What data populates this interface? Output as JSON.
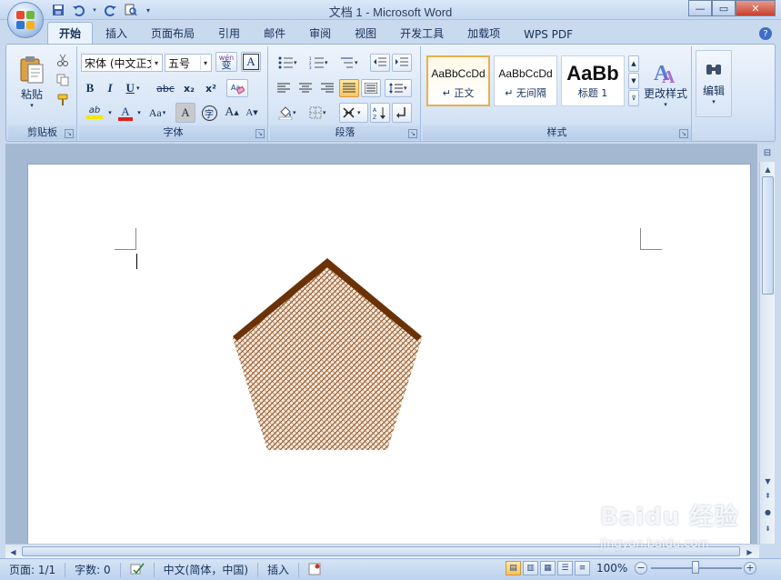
{
  "window": {
    "title": "文档 1 - Microsoft Word"
  },
  "tabs": [
    "开始",
    "插入",
    "页面布局",
    "引用",
    "邮件",
    "审阅",
    "视图",
    "开发工具",
    "加载项",
    "WPS PDF"
  ],
  "ribbon": {
    "clipboard": {
      "label": "剪贴板",
      "paste": "粘贴"
    },
    "font": {
      "label": "字体",
      "font_name": "宋体 (中文正文",
      "font_size": "五号",
      "wen_label": "wén\n变",
      "a_box": "A",
      "bold": "B",
      "italic": "I",
      "underline": "U",
      "strike": "abc",
      "subscript": "x₂",
      "superscript": "x²",
      "highlight": "ab",
      "fontcolor": "A",
      "case": "Aa",
      "shade_a": "A",
      "circle_char": "字",
      "grow": "A",
      "shrink": "A"
    },
    "paragraph": {
      "label": "段落"
    },
    "styles": {
      "label": "样式",
      "items": [
        {
          "sample": "AaBbCcDd",
          "name": "↵ 正文"
        },
        {
          "sample": "AaBbCcDd",
          "name": "↵ 无间隔"
        },
        {
          "sample": "AaBb",
          "name": "标题 1"
        }
      ],
      "change_styles": "更改样式"
    },
    "editing": {
      "label": "编辑"
    }
  },
  "status": {
    "page": "页面: 1/1",
    "words": "字数: 0",
    "language": "中文(简体，中国)",
    "mode": "插入",
    "zoom": "100%"
  },
  "watermark": {
    "brand": "Baidu 经验",
    "url": "jingyan.baidu.com"
  },
  "colors": {
    "pentagon_fill": "#8c4a1a",
    "pentagon_top": "#6b3208",
    "font_color_bar": "#e0201a",
    "highlight_bar": "#f2e800"
  }
}
